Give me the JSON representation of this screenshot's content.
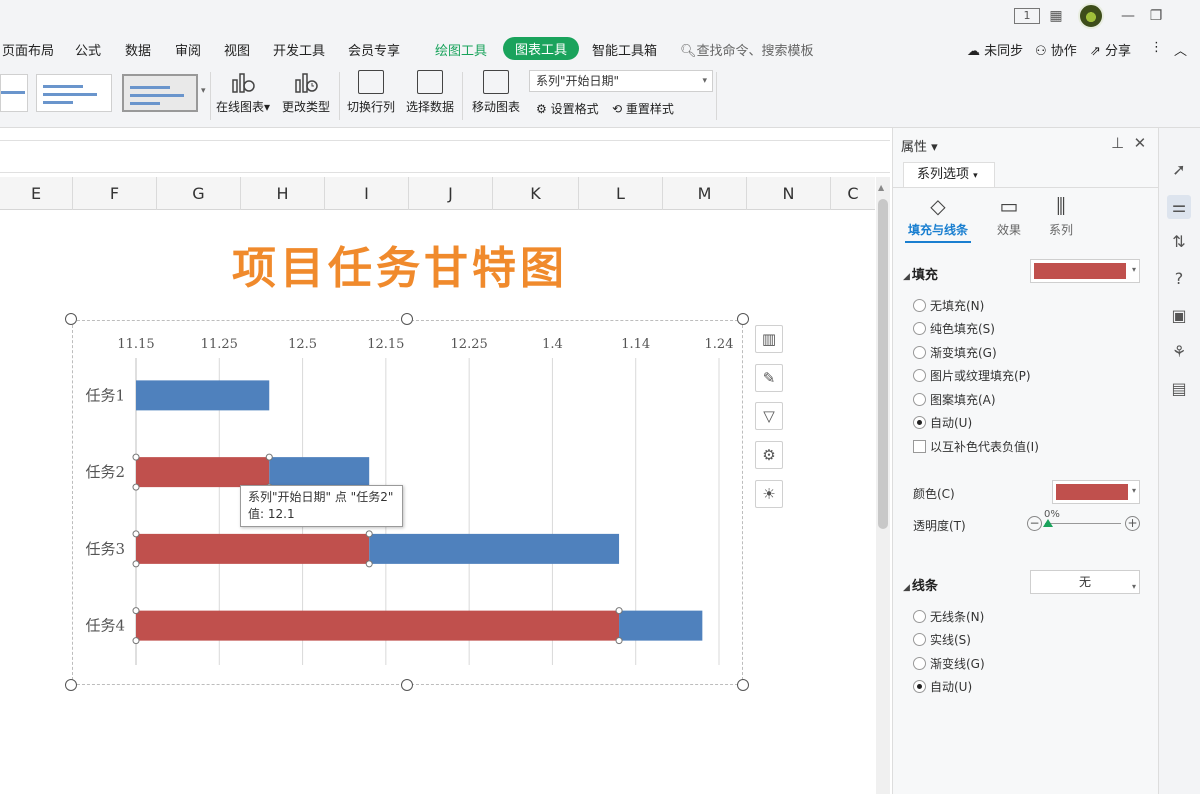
{
  "titlebar": {
    "page_indicator": "1",
    "icons": [
      "page-view-icon",
      "grid-icon",
      "avatar",
      "minimize-icon",
      "restore-icon"
    ]
  },
  "menu": {
    "items": [
      "页面布局",
      "公式",
      "数据",
      "审阅",
      "视图",
      "开发工具",
      "会员专享",
      "绘图工具",
      "图表工具",
      "智能工具箱"
    ],
    "search": "查找命令、搜索模板",
    "sync": "未同步",
    "collab": "协作",
    "share": "分享"
  },
  "ribbon": {
    "online_chart": "在线图表",
    "change_type": "更改类型",
    "switch_rowcol": "切换行列",
    "select_data": "选择数据",
    "move_chart": "移动图表",
    "series_select": "系列\"开始日期\"",
    "set_format": "设置格式",
    "reset_style": "重置样式"
  },
  "columns": [
    "E",
    "F",
    "G",
    "H",
    "I",
    "J",
    "K",
    "L",
    "M",
    "N",
    "C"
  ],
  "chart_title": "项目任务甘特图",
  "chart_data": {
    "type": "bar",
    "orientation": "horizontal",
    "stacked": true,
    "title": "项目任务甘特图",
    "x_ticks": [
      "11.15",
      "11.25",
      "12.5",
      "12.15",
      "12.25",
      "1.4",
      "1.14",
      "1.24"
    ],
    "xlim": [
      0,
      70
    ],
    "categories": [
      "任务1",
      "任务2",
      "任务3",
      "任务4"
    ],
    "series": [
      {
        "name": "开始日期",
        "color": "#c0504d",
        "values": [
          0,
          16,
          28,
          58
        ]
      },
      {
        "name": "",
        "color": "#4f81bd",
        "values": [
          16,
          12,
          30,
          10
        ]
      }
    ],
    "grid": true
  },
  "tooltip": {
    "line1": "系列\"开始日期\" 点 \"任务2\"",
    "line2": "值: 12.1"
  },
  "panel": {
    "title": "属性",
    "tab": "系列选项",
    "subtabs": [
      "填充与线条",
      "效果",
      "系列"
    ],
    "fill_header": "填充",
    "fill_color": "#c0504d",
    "fill_options": [
      "无填充(N)",
      "纯色填充(S)",
      "渐变填充(G)",
      "图片或纹理填充(P)",
      "图案填充(A)",
      "自动(U)"
    ],
    "fill_selected": "自动(U)",
    "invert_label": "以互补色代表负值(I)",
    "color_label": "颜色(C)",
    "transparency_label": "透明度(T)",
    "transparency_value": "0%",
    "line_header": "线条",
    "line_value": "无",
    "line_options": [
      "无线条(N)",
      "实线(S)",
      "渐变线(G)",
      "自动(U)"
    ],
    "line_selected": "自动(U)"
  }
}
